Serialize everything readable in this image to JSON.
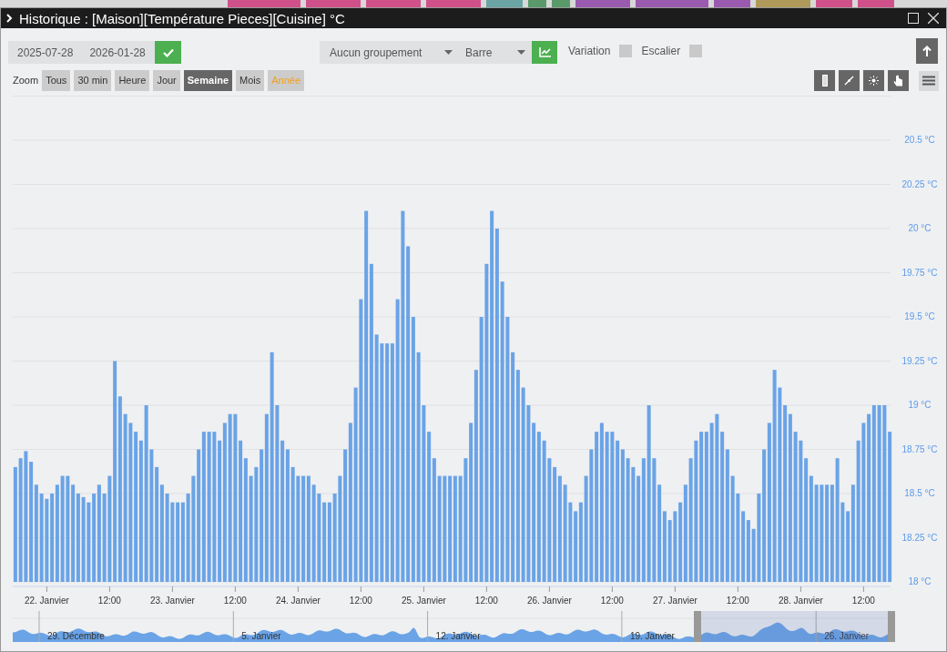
{
  "window": {
    "title": "Historique : [Maison][Température Pieces][Cuisine] °C"
  },
  "toolbar": {
    "start_date": "2025-07-28",
    "end_date": "2026-01-28",
    "grouping": "Aucun groupement",
    "chart_type": "Barre",
    "options": [
      {
        "label": "Variation",
        "checked": false
      },
      {
        "label": "Escalier",
        "checked": false
      }
    ]
  },
  "zoom": {
    "label": "Zoom",
    "buttons": [
      {
        "label": "Tous",
        "selected": false,
        "hovered": false
      },
      {
        "label": "30 min",
        "selected": false,
        "hovered": false
      },
      {
        "label": "Heure",
        "selected": false,
        "hovered": false
      },
      {
        "label": "Jour",
        "selected": false,
        "hovered": false
      },
      {
        "label": "Semaine",
        "selected": true,
        "hovered": false
      },
      {
        "label": "Mois",
        "selected": false,
        "hovered": false
      },
      {
        "label": "Année",
        "selected": false,
        "hovered": true
      }
    ]
  },
  "chart": {
    "chart_data": {
      "type": "bar",
      "categories": [
        null,
        null,
        null,
        null,
        null,
        null,
        "22. Janvier",
        null,
        null,
        null,
        null,
        null,
        null,
        null,
        null,
        null,
        null,
        null,
        "12:00",
        null,
        null,
        null,
        null,
        null,
        null,
        null,
        null,
        null,
        null,
        null,
        "23. Janvier",
        null,
        null,
        null,
        null,
        null,
        null,
        null,
        null,
        null,
        null,
        null,
        "12:00",
        null,
        null,
        null,
        null,
        null,
        null,
        null,
        null,
        null,
        null,
        null,
        "24. Janvier",
        null,
        null,
        null,
        null,
        null,
        null,
        null,
        null,
        null,
        null,
        null,
        "12:00",
        null,
        null,
        null,
        null,
        null,
        null,
        null,
        null,
        null,
        null,
        null,
        "25. Janvier",
        null,
        null,
        null,
        null,
        null,
        null,
        null,
        null,
        null,
        null,
        null,
        "12:00",
        null,
        null,
        null,
        null,
        null,
        null,
        null,
        null,
        null,
        null,
        null,
        "26. Janvier",
        null,
        null,
        null,
        null,
        null,
        null,
        null,
        null,
        null,
        null,
        null,
        "12:00",
        null,
        null,
        null,
        null,
        null,
        null,
        null,
        null,
        null,
        null,
        null,
        "27. Janvier",
        null,
        null,
        null,
        null,
        null,
        null,
        null,
        null,
        null,
        null,
        null,
        "12:00",
        null,
        null,
        null,
        null,
        null,
        null,
        null,
        null,
        null,
        null,
        null,
        "28. Janvier",
        null,
        null,
        null,
        null,
        null,
        null,
        null,
        null,
        null,
        null,
        null,
        "12:00",
        null,
        null,
        null,
        null,
        null
      ],
      "values": [
        18.65,
        18.7,
        18.74,
        18.68,
        18.55,
        18.5,
        18.47,
        18.5,
        18.55,
        18.6,
        18.6,
        18.55,
        18.5,
        18.48,
        18.45,
        18.5,
        18.55,
        18.5,
        18.6,
        19.25,
        19.05,
        18.95,
        18.9,
        18.85,
        18.8,
        19.0,
        18.75,
        18.65,
        18.55,
        18.5,
        18.45,
        18.45,
        18.45,
        18.5,
        18.6,
        18.75,
        18.85,
        18.85,
        18.85,
        18.8,
        18.9,
        18.95,
        18.95,
        18.8,
        18.7,
        18.6,
        18.65,
        18.75,
        18.95,
        19.3,
        19.0,
        18.8,
        18.75,
        18.65,
        18.6,
        18.6,
        18.6,
        18.55,
        18.5,
        18.45,
        18.45,
        18.5,
        18.6,
        18.75,
        18.9,
        19.1,
        19.6,
        20.1,
        19.8,
        19.4,
        19.35,
        19.35,
        19.35,
        19.6,
        20.1,
        19.9,
        19.5,
        19.3,
        19.0,
        18.85,
        18.7,
        18.6,
        18.6,
        18.6,
        18.6,
        18.6,
        18.7,
        18.9,
        19.2,
        19.5,
        19.8,
        20.1,
        20.0,
        19.7,
        19.5,
        19.3,
        19.2,
        19.1,
        19.0,
        18.9,
        18.85,
        18.8,
        18.7,
        18.65,
        18.6,
        18.55,
        18.45,
        18.4,
        18.45,
        18.6,
        18.75,
        18.85,
        18.9,
        18.85,
        18.85,
        18.8,
        18.75,
        18.7,
        18.65,
        18.6,
        18.7,
        19.0,
        18.7,
        18.55,
        18.4,
        18.35,
        18.4,
        18.45,
        18.55,
        18.7,
        18.8,
        18.85,
        18.85,
        18.9,
        18.95,
        18.85,
        18.75,
        18.6,
        18.5,
        18.4,
        18.35,
        18.3,
        18.5,
        18.75,
        18.9,
        19.2,
        19.1,
        19.0,
        18.95,
        18.85,
        18.8,
        18.7,
        18.6,
        18.55,
        18.55,
        18.55,
        18.55,
        18.7,
        18.45,
        18.4,
        18.55,
        18.8,
        18.9,
        18.95,
        19.0,
        19.0,
        19.0,
        18.85
      ],
      "ylim": [
        18,
        20.75
      ],
      "grid": true,
      "yticks": [
        {
          "value": 18,
          "label": "18 °C"
        },
        {
          "value": 18.25,
          "label": "18.25 °C"
        },
        {
          "value": 18.5,
          "label": "18.5 °C"
        },
        {
          "value": 18.75,
          "label": "18.75 °C"
        },
        {
          "value": 19,
          "label": "19 °C"
        },
        {
          "value": 19.25,
          "label": "19.25 °C"
        },
        {
          "value": 19.5,
          "label": "19.5 °C"
        },
        {
          "value": 19.75,
          "label": "19.75 °C"
        },
        {
          "value": 20,
          "label": "20 °C"
        },
        {
          "value": 20.25,
          "label": "20.25 °C"
        },
        {
          "value": 20.5,
          "label": "20.5 °C"
        }
      ]
    }
  },
  "navigator": {
    "labels": [
      "29. Décembre",
      "5. Janvier",
      "12. Janvier",
      "19. Janvier",
      "26. Janvier"
    ]
  }
}
